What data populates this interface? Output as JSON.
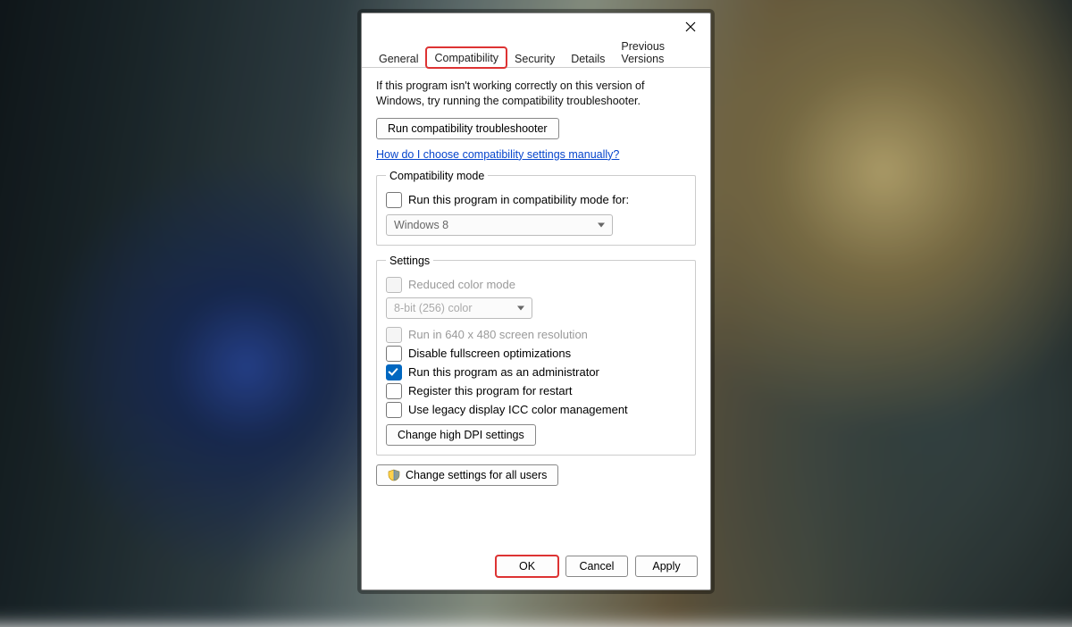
{
  "tabs": {
    "general": "General",
    "compatibility": "Compatibility",
    "security": "Security",
    "details": "Details",
    "previous": "Previous Versions"
  },
  "intro": "If this program isn't working correctly on this version of Windows, try running the compatibility troubleshooter.",
  "troubleshooter_btn": "Run compatibility troubleshooter",
  "manual_link": "How do I choose compatibility settings manually?",
  "compat_mode": {
    "legend": "Compatibility mode",
    "checkbox": "Run this program in compatibility mode for:",
    "select_value": "Windows 8"
  },
  "settings": {
    "legend": "Settings",
    "reduced_color": "Reduced color mode",
    "color_select": "8-bit (256) color",
    "low_res": "Run in 640 x 480 screen resolution",
    "disable_fullscreen": "Disable fullscreen optimizations",
    "run_admin": "Run this program as an administrator",
    "register_restart": "Register this program for restart",
    "legacy_icc": "Use legacy display ICC color management",
    "dpi_btn": "Change high DPI settings"
  },
  "all_users_btn": "Change settings for all users",
  "footer": {
    "ok": "OK",
    "cancel": "Cancel",
    "apply": "Apply"
  }
}
